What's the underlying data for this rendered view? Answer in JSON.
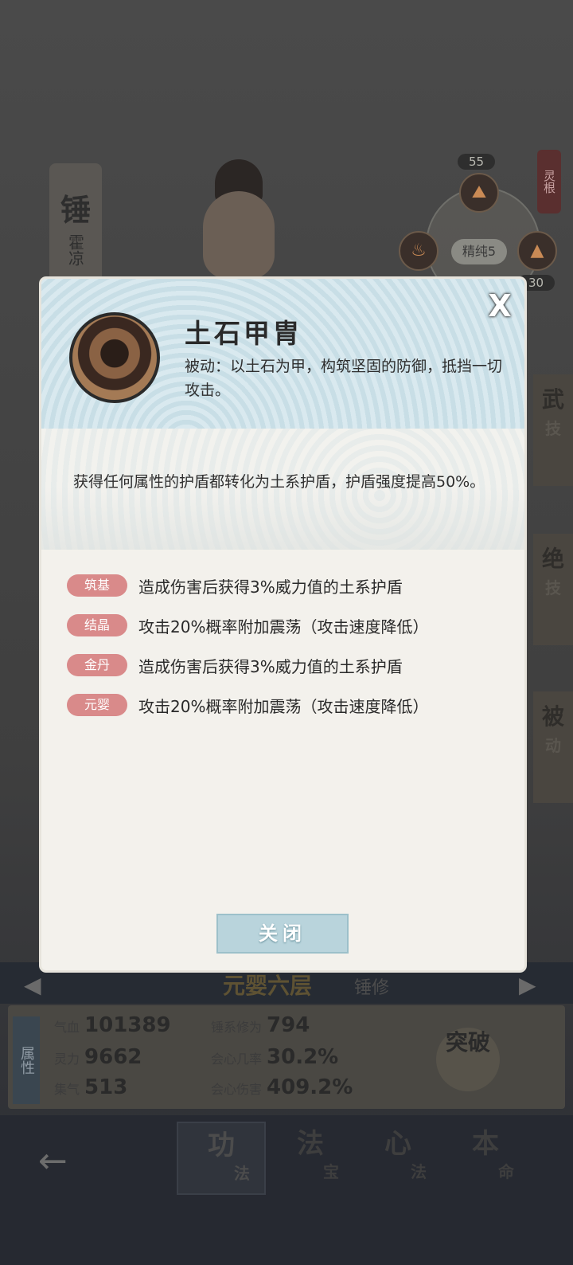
{
  "background": {
    "weapon_tag": {
      "char": "锤",
      "name": "霍凉"
    },
    "spirit_root": {
      "label": "灵根",
      "purity": "精纯5",
      "top_value": "55",
      "side_value": "30"
    },
    "side_tabs": [
      {
        "main": "武",
        "sub": "技"
      },
      {
        "main": "绝",
        "sub": "技"
      },
      {
        "main": "被",
        "sub": "动"
      }
    ],
    "rank": {
      "title": "元婴六层",
      "sub": "锤修"
    },
    "stats": {
      "label": "属性",
      "items": [
        {
          "key": "气血",
          "value": "101389"
        },
        {
          "key": "锤系修为",
          "value": "794"
        },
        {
          "key": "灵力",
          "value": "9662"
        },
        {
          "key": "会心几率",
          "value": "30.2%"
        },
        {
          "key": "集气",
          "value": "513"
        },
        {
          "key": "会心伤害",
          "value": "409.2%"
        }
      ],
      "breakthrough": "突破"
    },
    "nav": [
      {
        "main": "功",
        "sub": "法"
      },
      {
        "main": "法",
        "sub": "宝"
      },
      {
        "main": "心",
        "sub": "法"
      },
      {
        "main": "本",
        "sub": "命"
      }
    ]
  },
  "dialog": {
    "skill_name": "土石甲胄",
    "passive_desc": "被动：以土石为甲，构筑坚固的防御，抵挡一切攻击。",
    "effect_desc": "获得任何属性的护盾都转化为土系护盾，护盾强度提高50%。",
    "tiers": [
      {
        "badge": "筑基",
        "text": "造成伤害后获得3%威力值的土系护盾"
      },
      {
        "badge": "结晶",
        "text": "攻击20%概率附加震荡（攻击速度降低）"
      },
      {
        "badge": "金丹",
        "text": "造成伤害后获得3%威力值的土系护盾"
      },
      {
        "badge": "元婴",
        "text": "攻击20%概率附加震荡（攻击速度降低）"
      }
    ],
    "close_label": "关闭",
    "close_x": "X"
  }
}
